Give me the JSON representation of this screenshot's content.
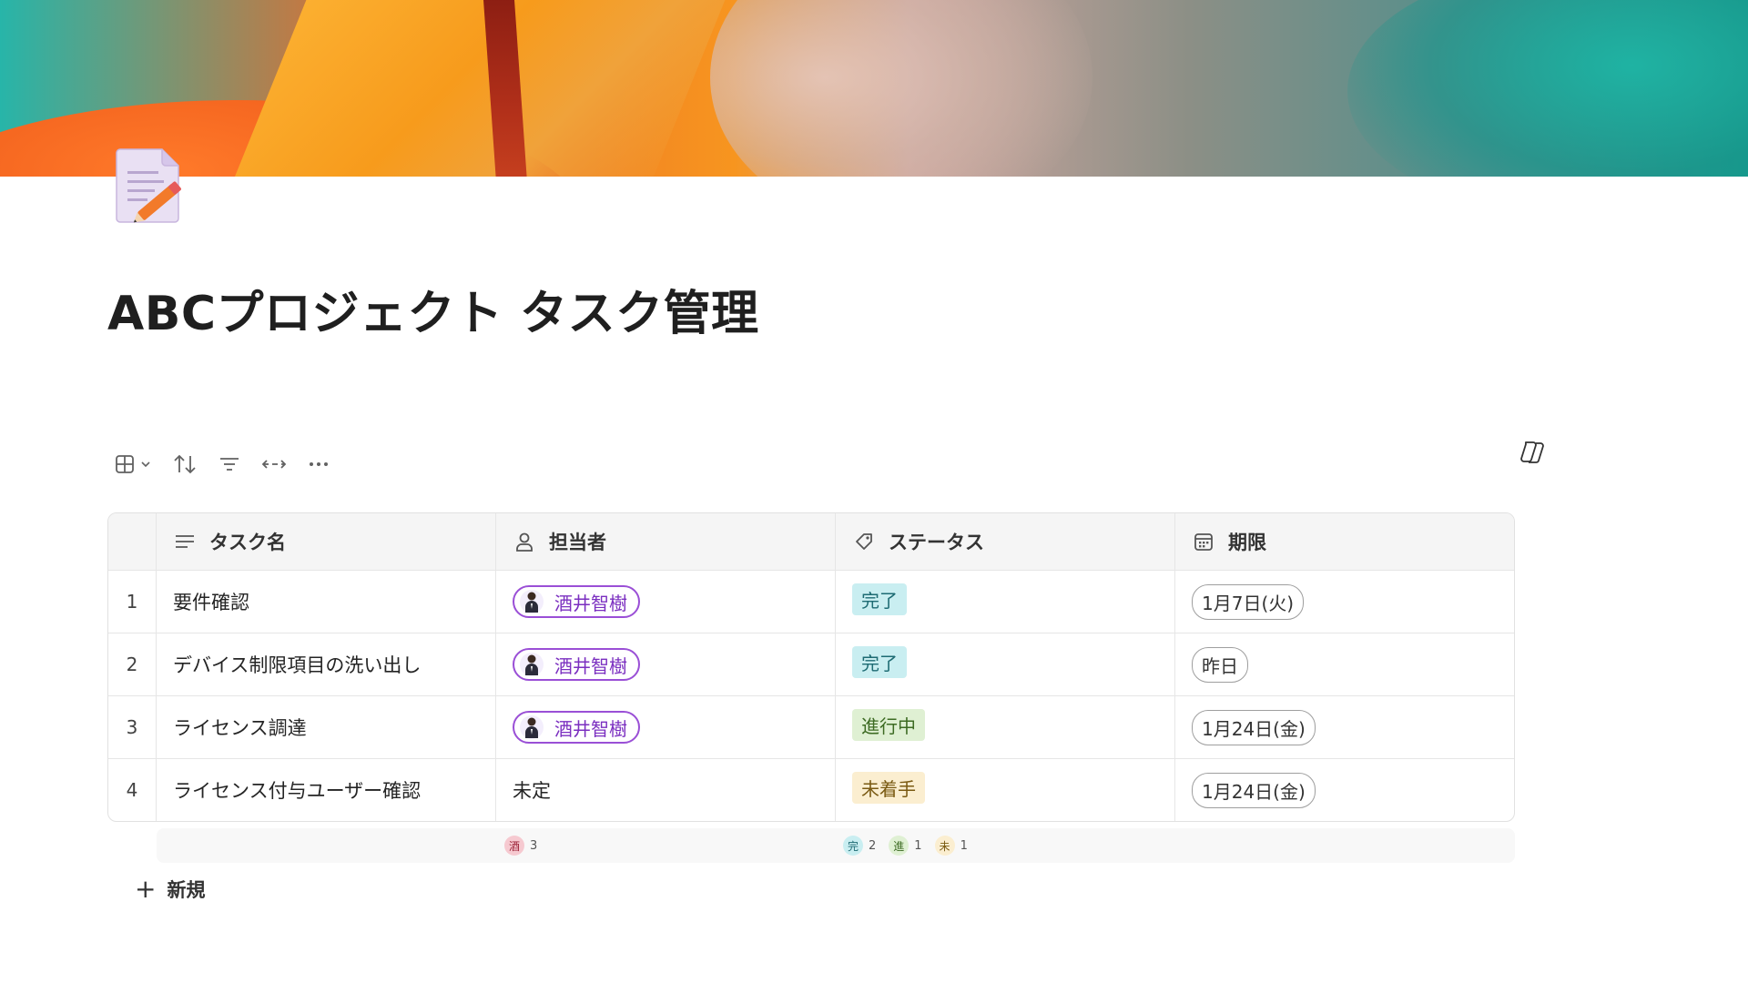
{
  "page": {
    "title": "ABCプロジェクト タスク管理",
    "icon": "memo-pencil-icon"
  },
  "toolbar": {
    "items": [
      "table-view-icon",
      "chevron-down-icon",
      "sort-icon",
      "filter-icon",
      "column-width-icon",
      "more-icon"
    ]
  },
  "copilot": {
    "icon": "copilot-icon"
  },
  "table": {
    "columns": [
      {
        "label": "タスク名",
        "icon": "text-lines-icon"
      },
      {
        "label": "担当者",
        "icon": "person-icon"
      },
      {
        "label": "ステータス",
        "icon": "tag-icon"
      },
      {
        "label": "期限",
        "icon": "calendar-icon"
      }
    ],
    "rows": [
      {
        "num": "1",
        "task": "要件確認",
        "assignee": "酒井智樹",
        "status": "完了",
        "due": "1月7日(火)"
      },
      {
        "num": "2",
        "task": "デバイス制限項目の洗い出し",
        "assignee": "酒井智樹",
        "status": "完了",
        "due": "昨日"
      },
      {
        "num": "3",
        "task": "ライセンス調達",
        "assignee": "酒井智樹",
        "status": "進行中",
        "due": "1月24日(金)"
      },
      {
        "num": "4",
        "task": "ライセンス付与ユーザー確認",
        "assignee": "未定",
        "status": "未着手",
        "due": "1月24日(金)"
      }
    ]
  },
  "status_colors": {
    "完了": {
      "bg": "#c9eef1",
      "fg": "#1d6b73"
    },
    "進行中": {
      "bg": "#dff0d3",
      "fg": "#3d6b23"
    },
    "未着手": {
      "bg": "#fbeed0",
      "fg": "#7a5a12"
    }
  },
  "summary": {
    "assignee": [
      {
        "letter": "酒",
        "count": "3",
        "bg": "#f6c9d0",
        "fg": "#9b2136"
      }
    ],
    "status": [
      {
        "letter": "完",
        "count": "2",
        "bg": "#c9eef1",
        "fg": "#1d6b73"
      },
      {
        "letter": "進",
        "count": "1",
        "bg": "#dff0d3",
        "fg": "#3d6b23"
      },
      {
        "letter": "未",
        "count": "1",
        "bg": "#fbeed0",
        "fg": "#7a5a12"
      }
    ]
  },
  "new_row": {
    "label": "新規"
  }
}
